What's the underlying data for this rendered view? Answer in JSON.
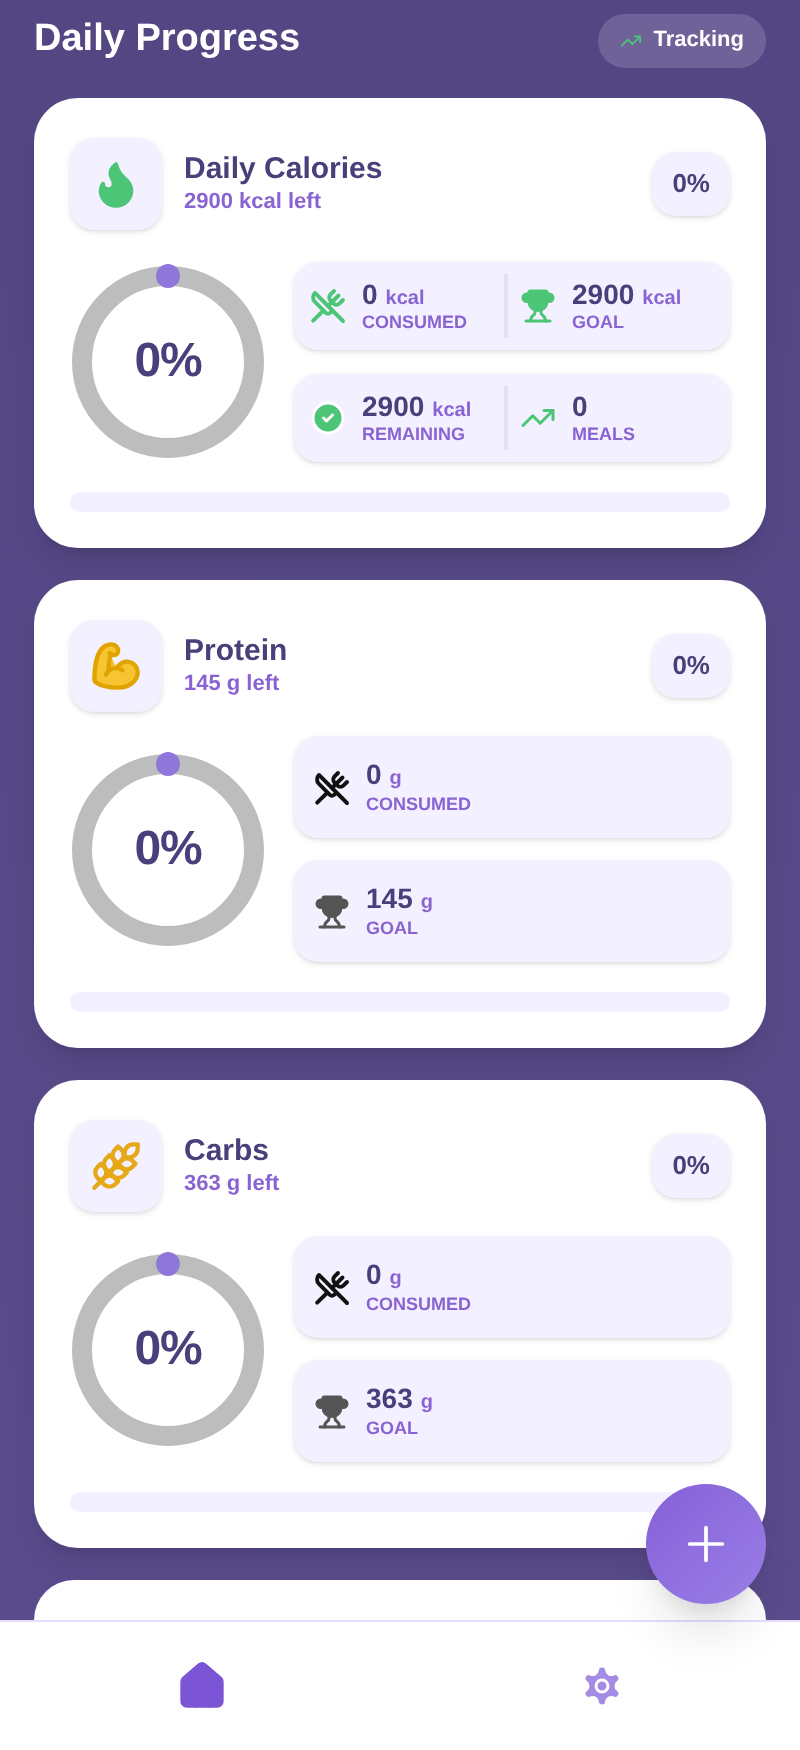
{
  "header": {
    "title": "Daily Progress",
    "badge": "Tracking"
  },
  "cards": [
    {
      "kind": "flame",
      "title": "Daily Calories",
      "subtitle": "2900 kcal left",
      "percent": "0%",
      "ring": {
        "label": "0%"
      },
      "bar": {
        "level": 0
      },
      "rows": [
        [
          {
            "kind": "consumed",
            "color": "#4cc676",
            "value": "0",
            "unit": "kcal",
            "label": "CONSUMED"
          },
          {
            "kind": "goal",
            "color": "#4cc676",
            "value": "2900",
            "unit": "kcal",
            "label": "GOAL"
          }
        ],
        [
          {
            "kind": "remaining",
            "color": "#4cc676",
            "value": "2900",
            "unit": "kcal",
            "label": "REMAINING"
          },
          {
            "kind": "meals",
            "color": "#4cc676",
            "value": "0",
            "label": "MEALS"
          }
        ]
      ]
    },
    {
      "kind": "muscle",
      "title": "Protein",
      "subtitle": "145 g left",
      "percent": "0%",
      "ring": {
        "label": "0%"
      },
      "bar": {
        "level": 0
      },
      "rows": [
        [
          {
            "kind": "consumed",
            "color": "#111111",
            "value": "0",
            "unit": "g",
            "label": "CONSUMED"
          }
        ],
        [
          {
            "kind": "goal",
            "color": "#555555",
            "value": "145",
            "unit": "g",
            "label": "GOAL"
          }
        ]
      ]
    },
    {
      "kind": "wheat",
      "title": "Carbs",
      "subtitle": "363 g left",
      "percent": "0%",
      "ring": {
        "label": "0%"
      },
      "bar": {
        "level": 0
      },
      "rows": [
        [
          {
            "kind": "consumed",
            "color": "#111111",
            "value": "0",
            "unit": "g",
            "label": "CONSUMED"
          }
        ],
        [
          {
            "kind": "goal",
            "color": "#555555",
            "value": "363",
            "unit": "g",
            "label": "GOAL"
          }
        ]
      ]
    }
  ],
  "nav": [
    {
      "kind": "home",
      "selected": true
    },
    {
      "kind": "settings",
      "selected": false
    }
  ]
}
